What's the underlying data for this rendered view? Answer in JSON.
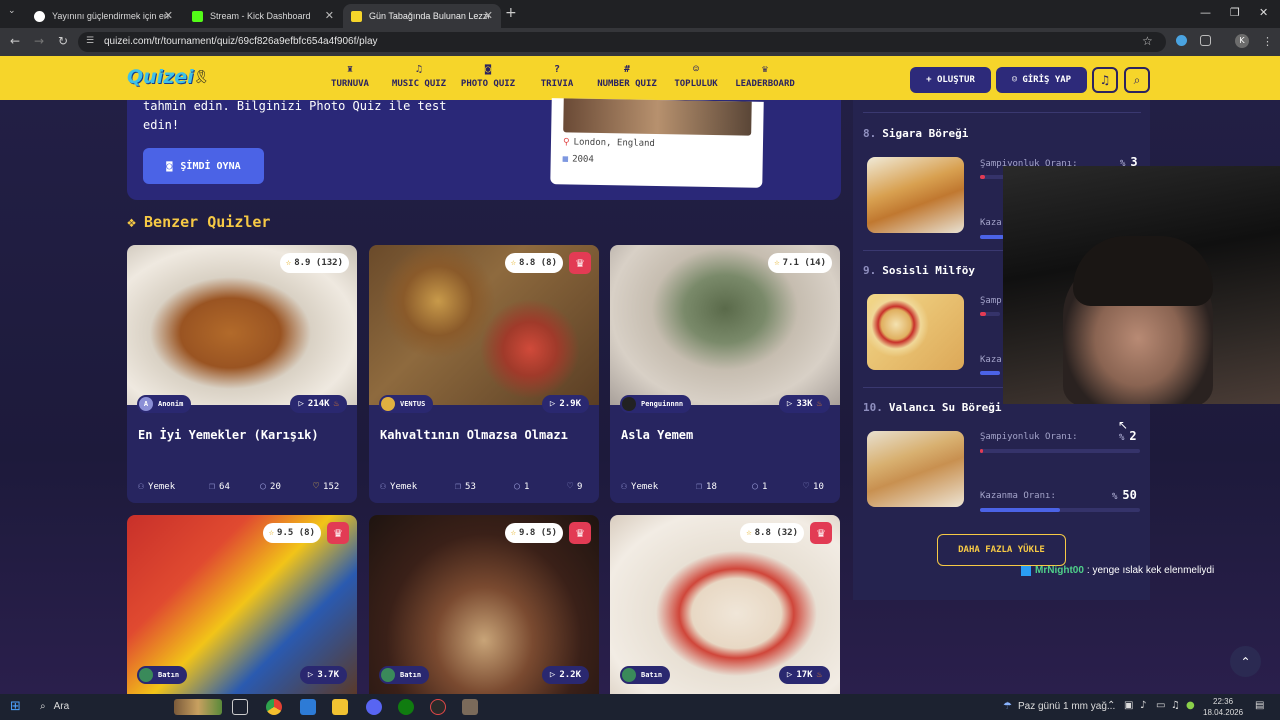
{
  "browser": {
    "tabs": [
      {
        "title": "Yayınını güçlendirmek için en iyi",
        "color": "#ffffff"
      },
      {
        "title": "Stream - Kick Dashboard",
        "color": "#53fc18"
      },
      {
        "title": "Gün Tabağında Bulunan Lezzet",
        "color": "#f6d52a"
      }
    ],
    "url": "quizei.com/tr/tournament/quiz/69cf826a9efbfc654a4f906f/play",
    "avatar": "K"
  },
  "site": {
    "logo": "Quizei",
    "nav": [
      {
        "label": "TURNUVA",
        "icon": "trophy-icon",
        "glyph": "♜"
      },
      {
        "label": "MUSIC QUIZ",
        "icon": "music-icon",
        "glyph": "♫"
      },
      {
        "label": "PHOTO QUIZ",
        "icon": "camera-icon",
        "glyph": "◙"
      },
      {
        "label": "TRIVIA",
        "icon": "question-icon",
        "glyph": "?"
      },
      {
        "label": "NUMBER QUIZ",
        "icon": "hash-icon",
        "glyph": "#"
      },
      {
        "label": "TOPLULUK",
        "icon": "users-icon",
        "glyph": "☺"
      },
      {
        "label": "LEADERBOARD",
        "icon": "shield-icon",
        "glyph": "♛"
      }
    ],
    "create_label": "+ OLUŞTUR",
    "login_label": "GİRİŞ YAP"
  },
  "hero": {
    "text": "tahmin edin. Bilginizi Photo Quiz ile test edin!",
    "play_label": "ŞİMDİ OYNA",
    "location": "London, England",
    "year": "2004"
  },
  "similar": {
    "title": "Benzer Quizler",
    "cards": [
      {
        "rating": "8.9",
        "count": "(132)",
        "author": "Anonim",
        "plays": "214K",
        "title": "En İyi Yemekler (Karışık)",
        "category": "Yemek",
        "questions": "64",
        "comments": "20",
        "likes": "152",
        "premium": false
      },
      {
        "rating": "8.8",
        "count": "(8)",
        "author": "VENTUS",
        "plays": "2.9K",
        "title": "Kahvaltının Olmazsa Olmazı",
        "category": "Yemek",
        "questions": "53",
        "comments": "1",
        "likes": "9",
        "premium": true
      },
      {
        "rating": "7.1",
        "count": "(14)",
        "author": "Penguinnnn",
        "plays": "33K",
        "title": "Asla Yemem",
        "category": "Yemek",
        "questions": "18",
        "comments": "1",
        "likes": "10",
        "premium": false
      },
      {
        "rating": "9.5",
        "count": "(8)",
        "author": "Batın",
        "plays": "3.7K",
        "premium": true
      },
      {
        "rating": "9.8",
        "count": "(5)",
        "author": "Batın",
        "plays": "2.2K",
        "premium": true
      },
      {
        "rating": "8.8",
        "count": "(32)",
        "author": "Batın",
        "plays": "17K",
        "premium": true
      }
    ]
  },
  "ranking": {
    "items": [
      {
        "rank": "8.",
        "name": "Sigara Böreği",
        "champ_label": "Şampiyonluk Oranı:",
        "champ_value": "3",
        "champ_progress": 0.03
      },
      {
        "rank": "9.",
        "name": "Sosisli Milföy",
        "champ_label": "Şamp",
        "win_label": "Kaza"
      },
      {
        "rank": "10.",
        "name": "Valancı Su Böreği",
        "champ_label": "Şampiyonluk Oranı:",
        "champ_value": "2",
        "champ_progress": 0.02,
        "win_label": "Kazanma Oranı:",
        "win_value": "50",
        "win_progress": 0.5
      }
    ],
    "percent": "%",
    "load_more": "DAHA FAZLA YÜKLE",
    "partial_win_label": "Kaza"
  },
  "chat": {
    "user": "MrNight00",
    "message": ": yenge ıslak kek elenmeliydi"
  },
  "taskbar": {
    "search": "Ara",
    "weather": "Paz günü 1 mm yağ...",
    "time": "22:36",
    "date": "18.04.2026"
  }
}
